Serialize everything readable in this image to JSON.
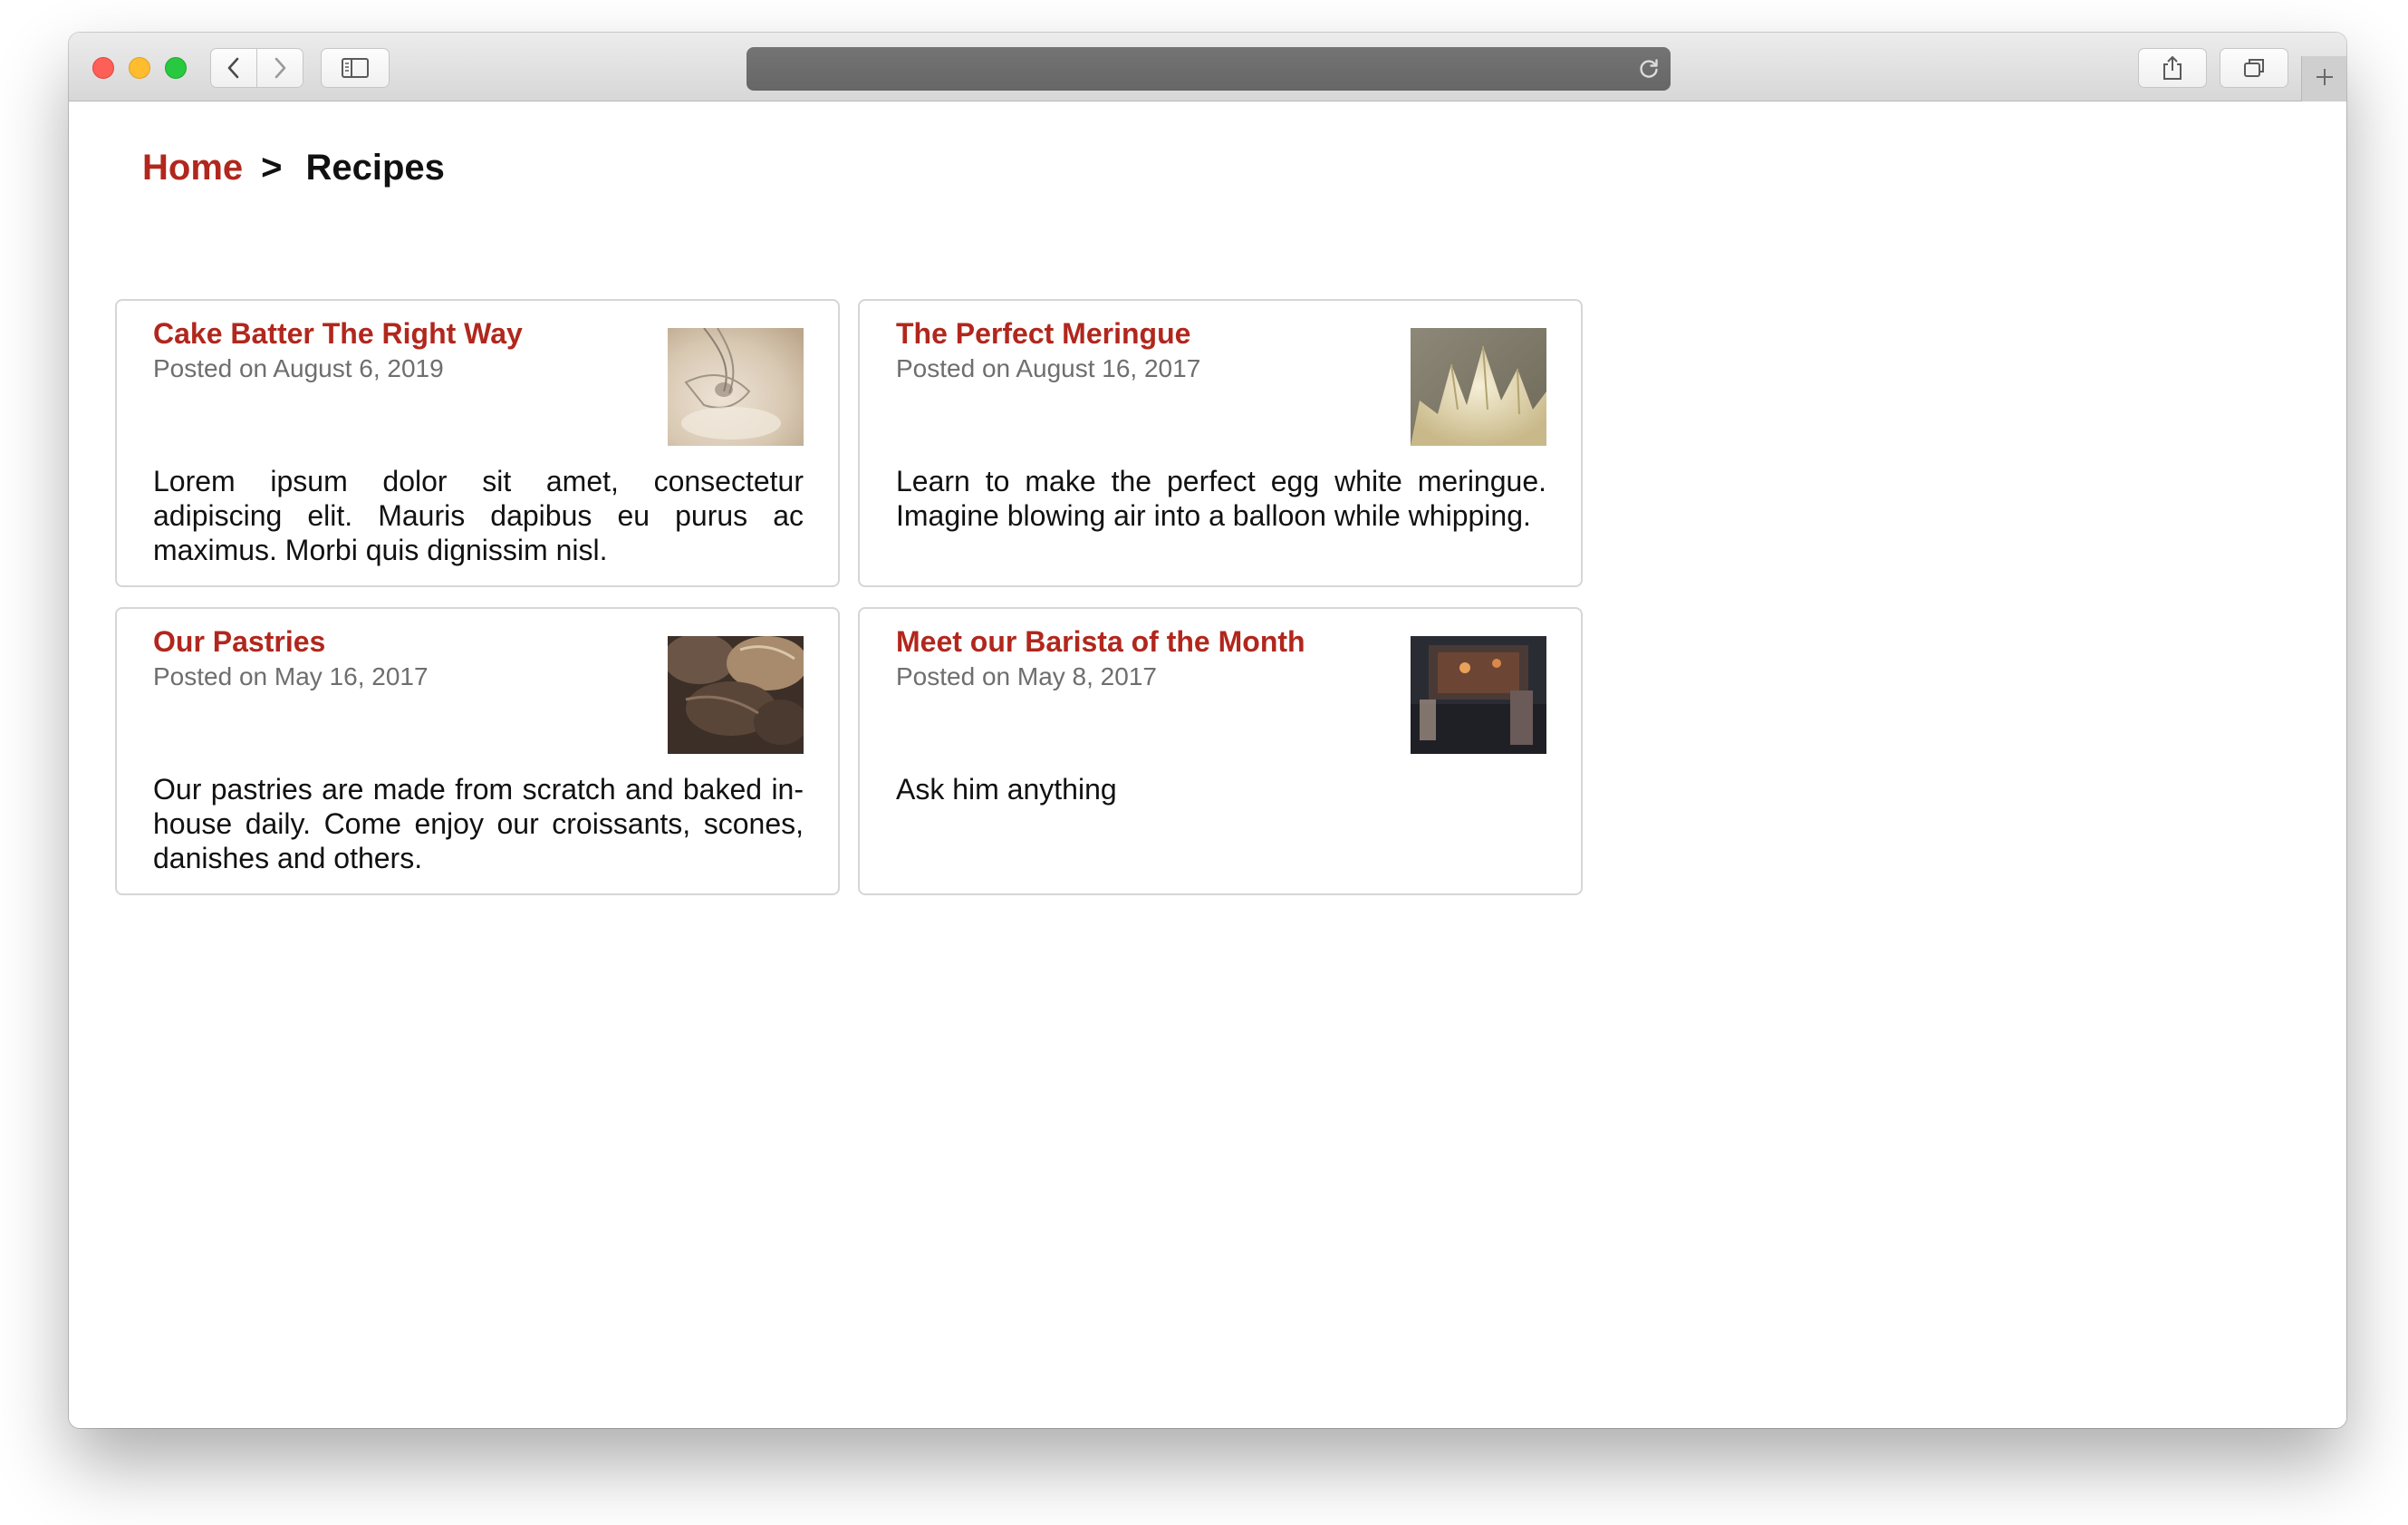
{
  "browser": {
    "nav_back_icon": "chevron-left-icon",
    "nav_forward_icon": "chevron-right-icon",
    "sidebar_icon": "sidebar-icon",
    "reload_icon": "reload-icon",
    "share_icon": "share-icon",
    "tabs_icon": "tabs-overview-icon",
    "new_tab_icon": "plus-icon",
    "url": ""
  },
  "breadcrumb": {
    "home_label": "Home",
    "separator": ">",
    "current_label": "Recipes"
  },
  "colors": {
    "accent": "#b1271d",
    "text": "#111111",
    "muted": "#6e6e6e",
    "card_border": "#d6d6d6"
  },
  "posts": [
    {
      "title": "Cake Batter The Right Way",
      "date": "Posted on August 6, 2019",
      "excerpt": "Lorem ipsum dolor sit amet, consectetur adipiscing elit. Mauris dapibus eu purus ac maximus. Morbi quis dignissim nisl.",
      "thumbnail": "whisk-in-batter-photo"
    },
    {
      "title": "The Perfect Meringue",
      "date": "Posted on August 16, 2017",
      "excerpt": "Learn to make the perfect egg white meringue. Imagine blowing air into a balloon while whipping.",
      "thumbnail": "meringue-peaks-photo"
    },
    {
      "title": "Our Pastries",
      "date": "Posted on May 16, 2017",
      "excerpt": "Our pastries are made from scratch and baked in-house daily. Come enjoy our croissants, scones, danishes and others.",
      "thumbnail": "pastries-photo"
    },
    {
      "title": "Meet our Barista of the Month",
      "date": "Posted on May 8, 2017",
      "excerpt": "Ask him anything",
      "thumbnail": "barista-photo"
    }
  ]
}
